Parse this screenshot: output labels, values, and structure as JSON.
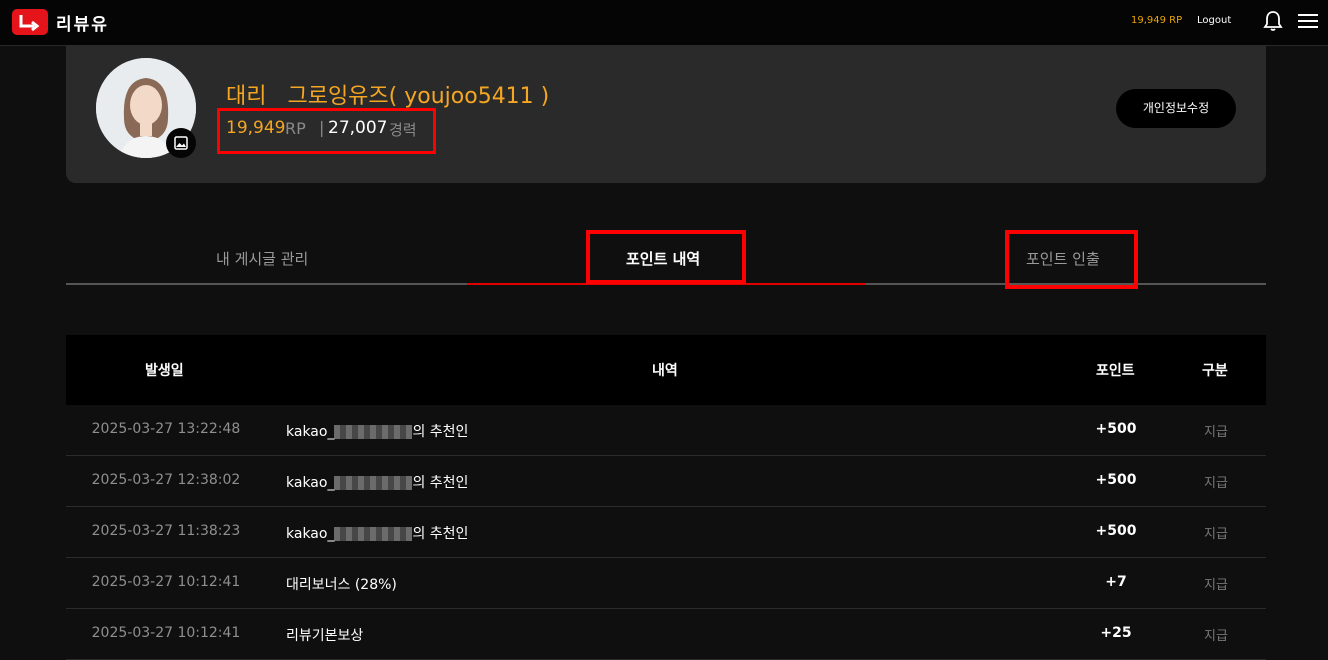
{
  "header": {
    "logo_text": "리뷰유",
    "rp": "19,949 RP",
    "logout": "Logout",
    "icons": [
      "bell-icon",
      "menu-icon"
    ]
  },
  "profile": {
    "name": "대리   그로잉유즈( youjoo5411 )",
    "rp_value": "19,949",
    "rp_unit": "RP",
    "separator": "|",
    "xp_value": "27,007",
    "xp_unit": "경력",
    "edit_label": "개인정보수정"
  },
  "tabs": [
    {
      "label": "내 게시글 관리",
      "active": false
    },
    {
      "label": "포인트 내역",
      "active": true
    },
    {
      "label": "포인트 인출",
      "active": false
    }
  ],
  "table": {
    "headers": [
      "발생일",
      "내역",
      "포인트",
      "구분"
    ],
    "rows": [
      {
        "date": "2025-03-27 13:22:48",
        "prefix": "kakao_",
        "suffix": "의 추천인",
        "points": "+500",
        "type": "지급"
      },
      {
        "date": "2025-03-27 12:38:02",
        "prefix": "kakao_",
        "suffix": "의 추천인",
        "points": "+500",
        "type": "지급"
      },
      {
        "date": "2025-03-27 11:38:23",
        "prefix": "kakao_",
        "suffix": "의 추천인",
        "points": "+500",
        "type": "지급"
      },
      {
        "date": "2025-03-27 10:12:41",
        "prefix": "대리보너스 (28%)",
        "suffix": "",
        "points": "+7",
        "type": "지급"
      },
      {
        "date": "2025-03-27 10:12:41",
        "prefix": "리뷰기본보상",
        "suffix": "",
        "points": "+25",
        "type": "지급"
      }
    ]
  },
  "colors": {
    "accent_orange": "#f5a623",
    "brand_red": "#e5141b",
    "highlight_red": "#ff0000"
  }
}
